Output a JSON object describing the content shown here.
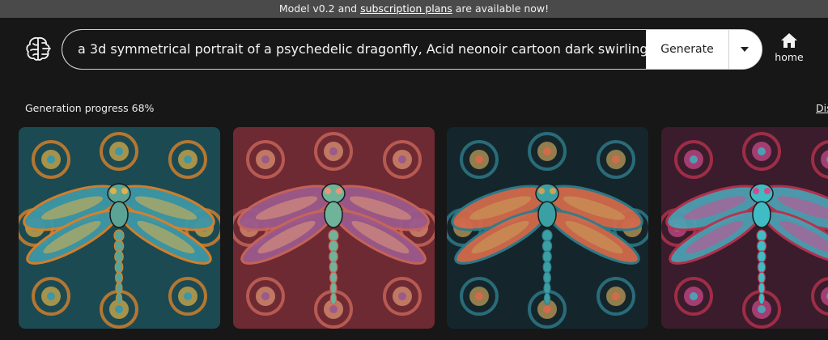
{
  "banner": {
    "prefix": "Model v0.2 and ",
    "link": "subscription plans",
    "suffix": " are available now!"
  },
  "prompt": {
    "value": "a 3d symmetrical portrait of a psychedelic dragonfly, Acid neonoir cartoon dark swirling"
  },
  "generate_label": "Generate",
  "nav": {
    "home_label": "home",
    "home_icon": "home-icon",
    "logo_icon": "brain-icon"
  },
  "progress": {
    "label": "Generation progress 68%",
    "percent": 68
  },
  "dismiss_label": "Dismiss",
  "results": [
    {
      "name": "dragonfly-image-1",
      "bg": "#1c4a52",
      "ring": "#d9822b",
      "wing": "#3e97a6",
      "body": "#5aa395",
      "accent": "#e0b24a"
    },
    {
      "name": "dragonfly-image-2",
      "bg": "#6e2a32",
      "ring": "#c9665a",
      "wing": "#9b5a8c",
      "body": "#6fb39a",
      "accent": "#e39a78"
    },
    {
      "name": "dragonfly-image-3",
      "bg": "#14262c",
      "ring": "#2f7d8c",
      "wing": "#d26a4c",
      "body": "#3aa0a4",
      "accent": "#c8a25a"
    },
    {
      "name": "dragonfly-image-4",
      "bg": "#3a1c2c",
      "ring": "#b8324e",
      "wing": "#4e9fb2",
      "body": "#3fbcc4",
      "accent": "#d24c8e"
    }
  ]
}
